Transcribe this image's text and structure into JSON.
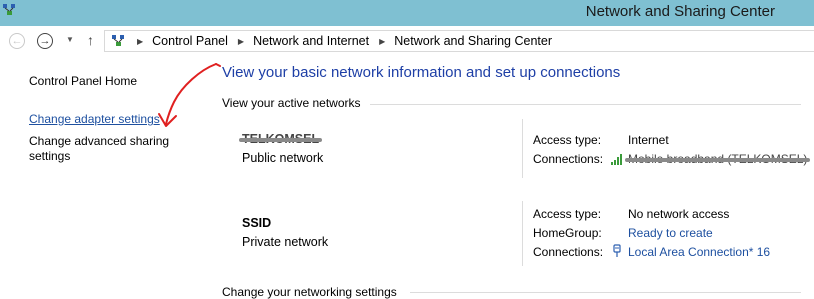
{
  "window": {
    "title": "Network and Sharing Center",
    "title_icon": "network-center-icon"
  },
  "address_bar": {
    "back_icon": "back-arrow-icon",
    "forward_icon": "forward-arrow-icon",
    "history_icon": "chevron-down-icon",
    "up_icon": "up-arrow-icon",
    "location_icon": "control-panel-icon",
    "separator": "▶",
    "breadcrumbs": [
      "Control Panel",
      "Network and Internet",
      "Network and Sharing Center"
    ]
  },
  "sidebar": {
    "home": "Control Panel Home",
    "links": [
      "Change adapter settings",
      "Change advanced sharing settings"
    ]
  },
  "main": {
    "title": "View your basic network information and set up connections",
    "active_networks_heading": "View your active networks",
    "change_settings_heading": "Change your networking settings",
    "networks": [
      {
        "name": "TELKOMSEL",
        "type": "Public network",
        "access_type_label": "Access type:",
        "access_type": "Internet",
        "connections_label": "Connections:",
        "connection": "Mobile broadband (TELKOMSEL)",
        "connection_icon": "signal-bars-icon"
      },
      {
        "name": "SSID",
        "type": "Private network",
        "access_type_label": "Access type:",
        "access_type": "No network access",
        "homegroup_label": "HomeGroup:",
        "homegroup": "Ready to create",
        "connections_label": "Connections:",
        "connection": "Local Area Connection* 16",
        "connection_icon": "ethernet-plug-icon"
      }
    ]
  },
  "annotation": {
    "icon": "red-arrow-annotation-icon",
    "color": "#e02020"
  },
  "colors": {
    "titlebar": "#7fc0d2",
    "link": "#1e50a0",
    "heading": "#1e3fa6"
  }
}
